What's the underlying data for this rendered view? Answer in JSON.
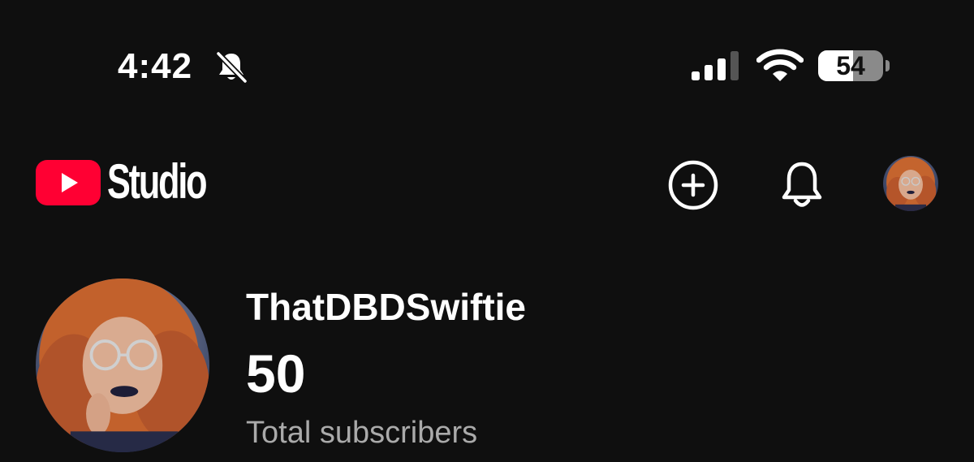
{
  "status_bar": {
    "time": "4:42",
    "mute_icon": "bell-slash-icon",
    "signal_icon": "cellular-signal-icon",
    "signal_bars_active": 3,
    "signal_bars_total": 4,
    "wifi_icon": "wifi-icon",
    "battery_percent": "54",
    "battery_level": 0.54
  },
  "header": {
    "logo_icon": "youtube-play-icon",
    "app_name": "Studio",
    "create_icon": "plus-circle-icon",
    "notifications_icon": "bell-icon",
    "account_avatar": "profile-avatar"
  },
  "channel": {
    "name": "ThatDBDSwiftie",
    "subscriber_count": "50",
    "subscriber_label": "Total subscribers"
  },
  "colors": {
    "background": "#0f0f0f",
    "brand_red": "#ff0033",
    "text_primary": "#ffffff",
    "text_secondary": "#aaaaaa"
  }
}
